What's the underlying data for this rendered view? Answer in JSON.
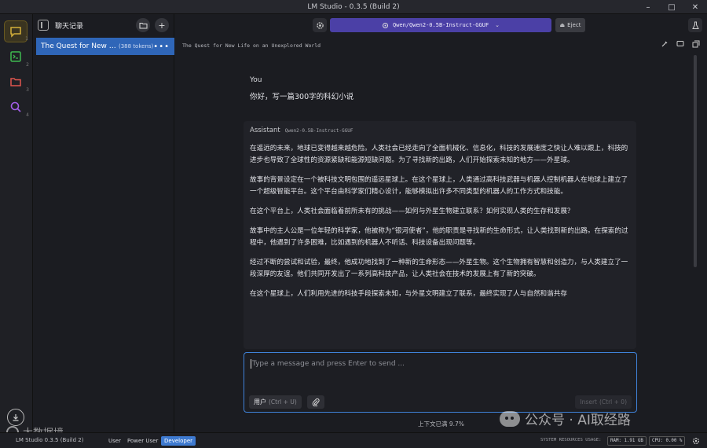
{
  "window": {
    "title": "LM Studio - 0.3.5 (Build 2)",
    "controls": [
      "minimize",
      "maximize",
      "close"
    ]
  },
  "rail": {
    "items": [
      {
        "icon": "chat-icon",
        "num": "1",
        "active": true,
        "color": "#d4b03a"
      },
      {
        "icon": "terminal-icon",
        "num": "2",
        "active": false,
        "color": "#3fb950"
      },
      {
        "icon": "folder-icon",
        "num": "3",
        "active": false,
        "color": "#e0564f"
      },
      {
        "icon": "search-icon",
        "num": "4",
        "active": false,
        "color": "#a35ee8"
      }
    ]
  },
  "sidebar": {
    "title": "聊天记录",
    "chat_item": {
      "name": "The Quest for New Life on an Unexplored World",
      "tokens": "(388 tokens)"
    }
  },
  "toolbar": {
    "model": "Qwen/Qwen2-0.5B-Instruct-GGUF",
    "eject": "Eject"
  },
  "chat": {
    "title": "The Quest for New Life on an Unexplored World",
    "user_role": "You",
    "user_message": "你好，写一篇300字的科幻小说",
    "assistant_role": "Assistant",
    "assistant_model": "Qwen2-0.5B-Instruct-GGUF",
    "paragraphs": [
      "在遥远的未来，地球已变得越来越危险。人类社会已经走向了全面机械化、信息化，科技的发展速度之快让人难以跟上，科技的进步也导致了全球性的资源紧缺和能源短缺问题。为了寻找新的出路，人们开始探索未知的地方——外星球。",
      "故事的背景设定在一个被科技文明包围的遥远星球上。在这个星球上，人类通过高科技武器与机器人控制机器人在地球上建立了一个超级智能平台。这个平台由科学家们精心设计，能够模拟出许多不同类型的机器人的工作方式和技能。",
      "在这个平台上，人类社会面临着前所未有的挑战——如何与外星生物建立联系？如何实现人类的生存和发展？",
      "故事中的主人公是一位年轻的科学家，他被称为“银河使者”，他的职责是寻找新的生命形式，让人类找到新的出路。在探索的过程中，他遇到了许多困难，比如遇到的机器人不听话、科技设备出现问题等。",
      "经过不断的尝试和试验，最终，他成功地找到了一种新的生命形态——外星生物。这个生物拥有智慧和创造力，与人类建立了一段深厚的友谊。他们共同开发出了一系列高科技产品，让人类社会在技术的发展上有了新的突破。",
      "在这个星球上，人们利用先进的科技手段探索未知，与外星文明建立了联系，最终实现了人与自然和谐共存"
    ]
  },
  "input": {
    "placeholder": "Type a message and press Enter to send ...",
    "role_label": "用户",
    "role_hint": "(Ctrl + U)",
    "insert_label": "Insert",
    "insert_hint": "(Ctrl + 0)"
  },
  "context_usage": "上下文已满 9.7%",
  "statusbar": {
    "app": "LM Studio 0.3.5 (Build 2)",
    "modes": [
      "User",
      "Power User",
      "Developer"
    ],
    "active_mode": "Developer",
    "sys_label": "SYSTEM RESOURCES USAGE:",
    "ram": "RAM: 1.91 GB",
    "cpu": "CPU: 0.00 %"
  },
  "watermarks": {
    "left": "大数据境",
    "right": "公众号 · AI取经路"
  },
  "colors": {
    "accent_blue": "#3e7ad0",
    "model_purple": "#4b40a6",
    "chat_selected": "#2f66b8"
  }
}
